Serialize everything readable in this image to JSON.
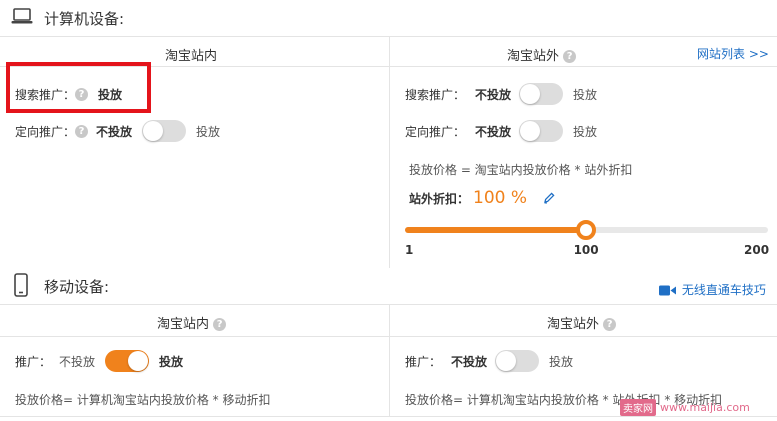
{
  "pc_section": {
    "title": "计算机设备:",
    "icon": "laptop-icon",
    "inside": {
      "title": "淘宝站内",
      "search_label": "搜索推广：",
      "search_state": "投放",
      "targeting_label": "定向推广：",
      "targeting_off": "不投放",
      "targeting_on": "投放",
      "targeting_enabled": false
    },
    "outside": {
      "title": "淘宝站外",
      "site_list_link": "网站列表 >>",
      "search_label": "搜索推广：",
      "search_off": "不投放",
      "search_on": "投放",
      "search_enabled": false,
      "targeting_label": "定向推广：",
      "targeting_off": "不投放",
      "targeting_on": "投放",
      "targeting_enabled": false,
      "price_formula": "投放价格 = 淘宝站内投放价格 * 站外折扣",
      "discount_label": "站外折扣：",
      "discount_value": "100 %",
      "slider": {
        "min": "1",
        "value": "100",
        "max": "200",
        "value_num": 100,
        "min_num": 1,
        "max_num": 200
      }
    }
  },
  "mobile_section": {
    "title": "移动设备:",
    "icon": "mobile-phone-icon",
    "tips_link": "无线直通车技巧",
    "inside": {
      "title": "淘宝站内",
      "promo_label": "推广：",
      "off": "不投放",
      "on": "投放",
      "enabled": true,
      "price_formula": "投放价格= 计算机淘宝站内投放价格 * 移动折扣"
    },
    "outside": {
      "title": "淘宝站外",
      "promo_label": "推广：",
      "off": "不投放",
      "on": "投放",
      "enabled": false,
      "price_formula": "投放价格= 计算机淘宝站内投放价格 * 站外折扣 * 移动折扣"
    }
  },
  "watermark": {
    "badge": "卖家网",
    "url": "www.maijia.com"
  },
  "colors": {
    "accent": "#f0821c",
    "link": "#1f6fc5",
    "highlight": "#e4141b"
  }
}
